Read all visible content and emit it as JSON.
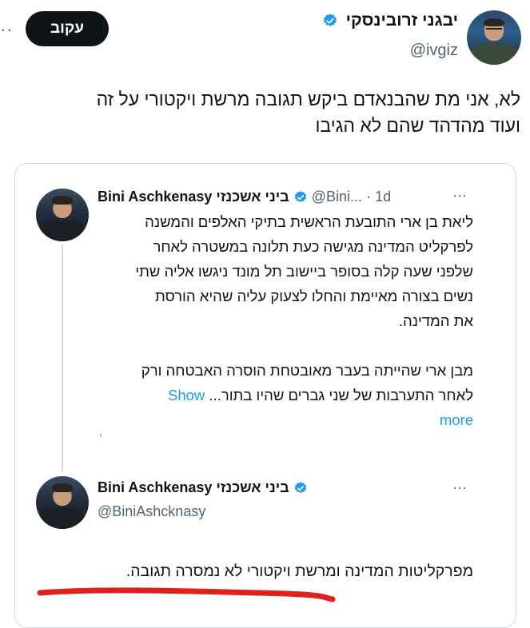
{
  "header": {
    "author_name": "יבגני זרובינסקי",
    "author_handle": "@ivgiz",
    "follow_label": "עקוב",
    "more_label": "··"
  },
  "main_tweet": {
    "line1": "לא, אני מת שהבנאדם ביקש תגובה מרשת ויקטורי על זה",
    "line2": "ועוד מהדהד שהם לא הגיבו"
  },
  "quote1": {
    "author_name_en": "Bini Aschkenasy",
    "author_name_he": "ביני אשכנזי",
    "handle": "@Bini...",
    "sep": "·",
    "time": "1d",
    "more_label": "···",
    "lines": [
      "ליאת בן ארי התובעת הראשית בתיקי האלפים והמשנה",
      "לפרקליט המדינה מגישה כעת תלונה במשטרה לאחר",
      "שלפני שעה קלה בסופר ביישוב תל מונד ניגשו אליה שתי",
      "נשים בצורה מאיימת והחלו לצעוק עליה שהיא הורסת",
      "את המדינה."
    ],
    "para2_line1": "מבן ארי שהייתה בעבר מאובטחת הוסרה האבטחה ורק",
    "para2_line2": "לאחר התערבות של שני גברים שהיו בתור...",
    "show_label": "Show",
    "more_link": "more",
    "tick": ","
  },
  "quote2": {
    "author_name_en": "Bini Aschkenasy",
    "author_name_he": "ביני אשכנזי",
    "handle": "@BiniAshcknasy",
    "more_label": "···",
    "text": "מפרקליטות המדינה ומרשת ויקטורי לא נמסרה תגובה."
  },
  "colors": {
    "accent": "#1d9bf0",
    "text": "#0f1419",
    "secondary": "#536471",
    "underline": "#e0201c"
  }
}
